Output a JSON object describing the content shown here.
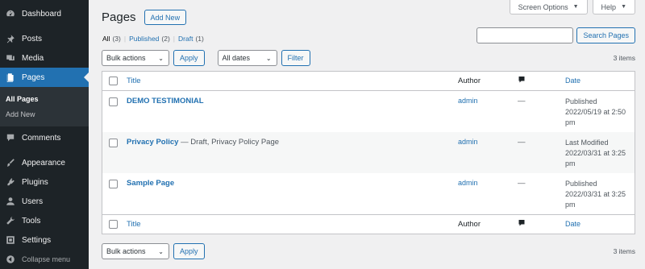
{
  "sidebar": {
    "items": [
      {
        "label": "Dashboard",
        "icon": "dashboard-icon"
      },
      {
        "label": "Posts",
        "icon": "pin-icon"
      },
      {
        "label": "Media",
        "icon": "media-icon"
      },
      {
        "label": "Pages",
        "icon": "pages-icon",
        "current": true
      },
      {
        "label": "Comments",
        "icon": "comment-icon"
      },
      {
        "label": "Appearance",
        "icon": "brush-icon"
      },
      {
        "label": "Plugins",
        "icon": "plugin-icon"
      },
      {
        "label": "Users",
        "icon": "users-icon"
      },
      {
        "label": "Tools",
        "icon": "wrench-icon"
      },
      {
        "label": "Settings",
        "icon": "settings-icon"
      }
    ],
    "submenu": [
      "All Pages",
      "Add New"
    ],
    "collapse_label": "Collapse menu"
  },
  "header": {
    "screen_options": "Screen Options",
    "help": "Help",
    "title": "Pages",
    "add_new": "Add New"
  },
  "filters": {
    "all": "All",
    "all_count": "(3)",
    "published": "Published",
    "published_count": "(2)",
    "draft": "Draft",
    "draft_count": "(1)",
    "separator": "|"
  },
  "search": {
    "button": "Search Pages",
    "value": ""
  },
  "tablenav_top": {
    "bulk_actions": "Bulk actions",
    "apply": "Apply",
    "dates": "All dates",
    "filter": "Filter",
    "count": "3 items"
  },
  "tablenav_bottom": {
    "bulk_actions": "Bulk actions",
    "apply": "Apply",
    "count": "3 items"
  },
  "table": {
    "columns": {
      "title": "Title",
      "author": "Author",
      "date": "Date"
    },
    "rows": [
      {
        "title": "DEMO TESTIMONIAL",
        "state": "",
        "author": "admin",
        "comments": "—",
        "date_status": "Published",
        "date_value": "2022/05/19 at 2:50 pm"
      },
      {
        "title": "Privacy Policy",
        "state": " — Draft, Privacy Policy Page",
        "author": "admin",
        "comments": "—",
        "date_status": "Last Modified",
        "date_value": "2022/03/31 at 3:25 pm"
      },
      {
        "title": "Sample Page",
        "state": "",
        "author": "admin",
        "comments": "—",
        "date_status": "Published",
        "date_value": "2022/03/31 at 3:25 pm"
      }
    ]
  },
  "colors": {
    "sidebar_bg": "#1d2327",
    "accent": "#2271b1",
    "page_bg": "#f0f0f1"
  }
}
